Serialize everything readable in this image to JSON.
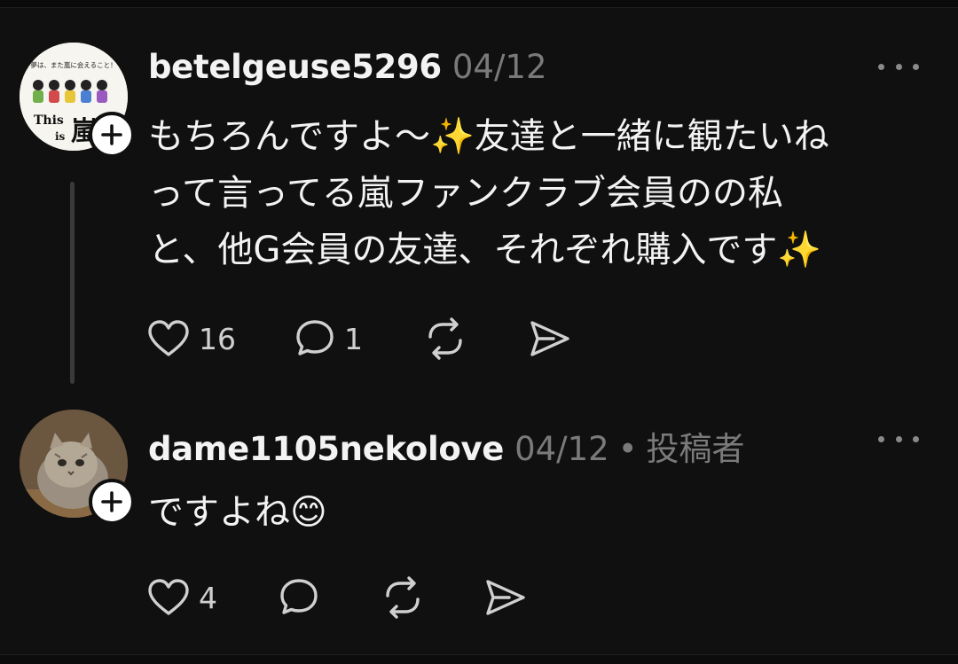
{
  "posts": [
    {
      "username": "betelgeuse5296",
      "timestamp": "04/12",
      "author_label": "",
      "text_lines": [
        "もちろんですよ〜✨友達と一緒に観たいね",
        "って言ってる嵐ファンクラブ会員のの私",
        "と、他G会員の友達、それぞれ購入です✨"
      ],
      "likes": "16",
      "replies": "1",
      "avatar_text_top": "夢は、また嵐に会えること！",
      "avatar_text_this": "This",
      "avatar_text_is": "is",
      "avatar_text_arashi": "嵐"
    },
    {
      "username": "dame1105nekolove",
      "timestamp": "04/12",
      "separator": "•",
      "author_label": "投稿者",
      "text_lines": [
        "ですよね😊"
      ],
      "likes": "4"
    }
  ],
  "icons": {
    "follow": "plus-icon",
    "more": "more-horizontal-icon",
    "like": "heart-icon",
    "reply": "comment-icon",
    "repost": "repost-icon",
    "share": "send-icon"
  },
  "colors": {
    "background": "#101010",
    "primary_text": "#f3f3f3",
    "secondary_text": "#7a7a7a"
  }
}
